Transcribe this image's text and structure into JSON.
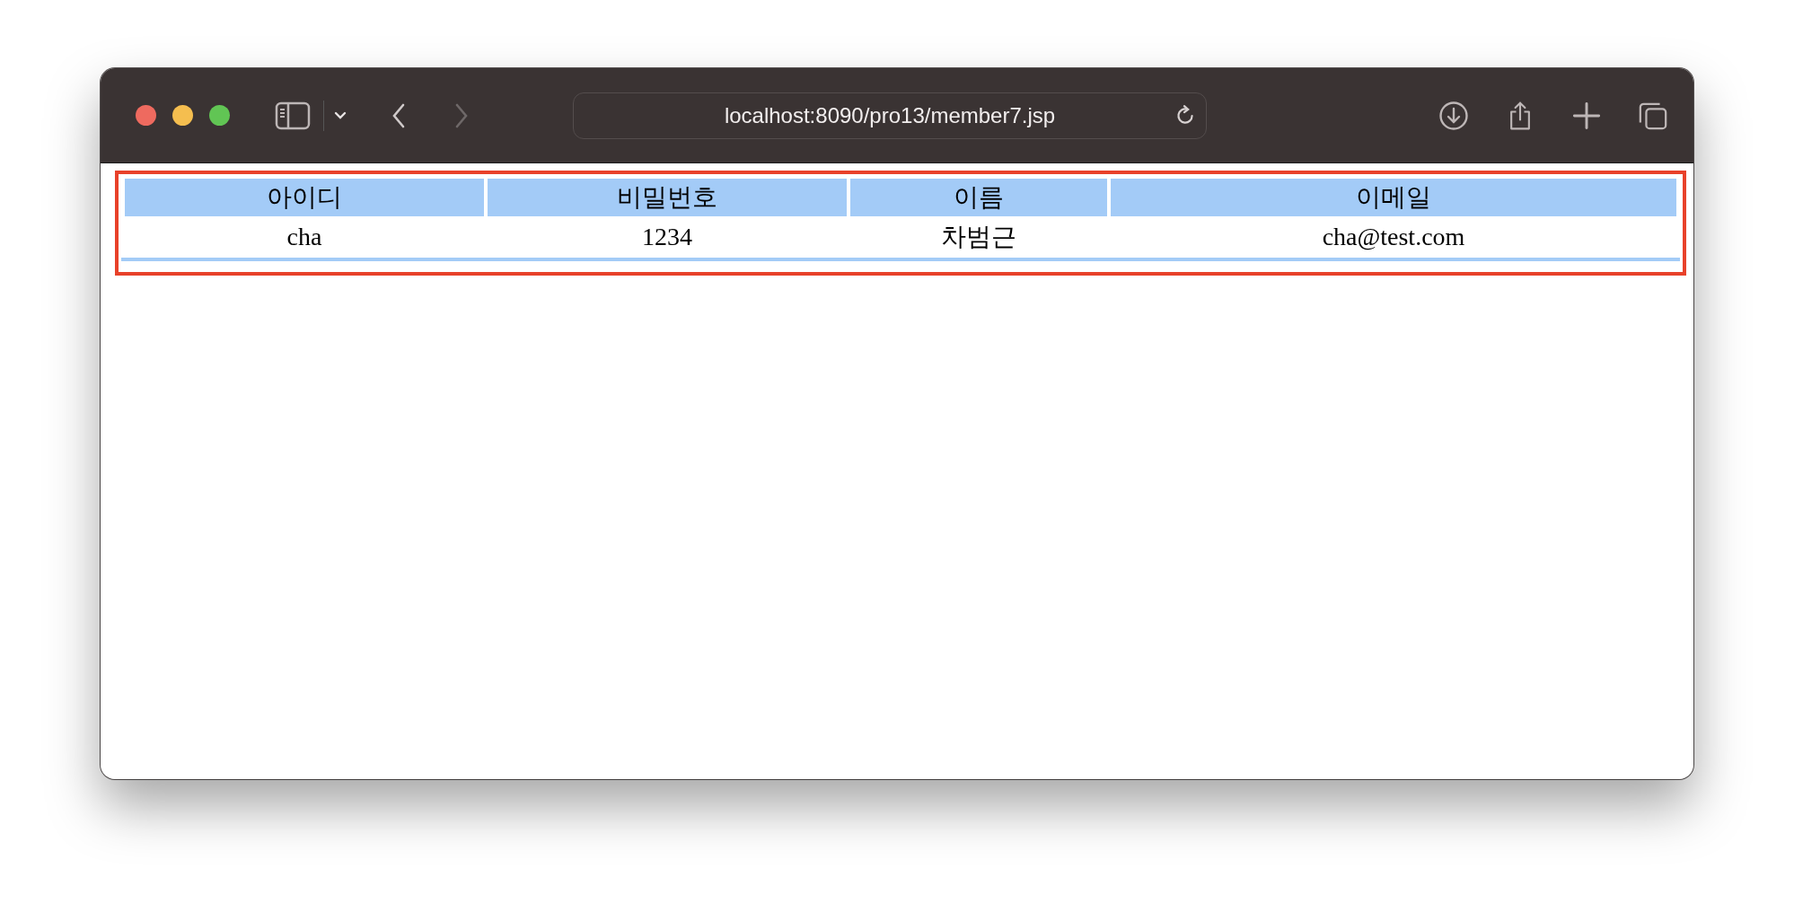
{
  "browser": {
    "url": "localhost:8090/pro13/member7.jsp"
  },
  "table": {
    "columns": [
      "아이디",
      "비밀번호",
      "이름",
      "이메일"
    ],
    "rows": [
      [
        "cha",
        "1234",
        "차범근",
        "cha@test.com"
      ]
    ]
  }
}
